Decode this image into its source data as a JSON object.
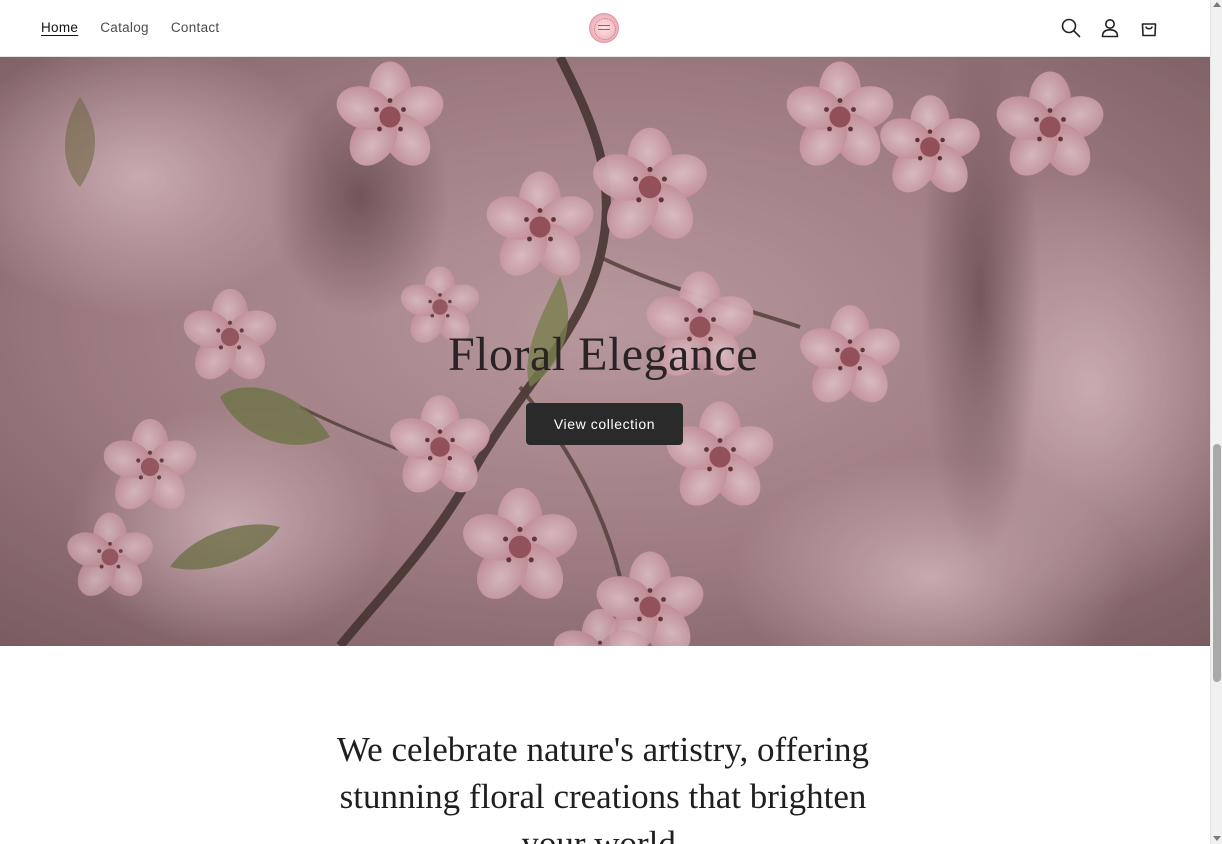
{
  "header": {
    "nav": [
      {
        "label": "Home",
        "active": true
      },
      {
        "label": "Catalog",
        "active": false
      },
      {
        "label": "Contact",
        "active": false
      }
    ],
    "logo_icon": "flower-shop-logo",
    "icons": [
      "search-icon",
      "account-icon",
      "cart-icon"
    ]
  },
  "hero": {
    "title": "Floral Elegance",
    "button_label": "View collection"
  },
  "intro": {
    "line1": "We celebrate nature's artistry, offering",
    "line2": "stunning floral creations that brighten",
    "line3": "your world."
  },
  "colors": {
    "button_bg": "#2b2a2a",
    "hero_tint": "#8e6f75",
    "text": "#121212"
  }
}
